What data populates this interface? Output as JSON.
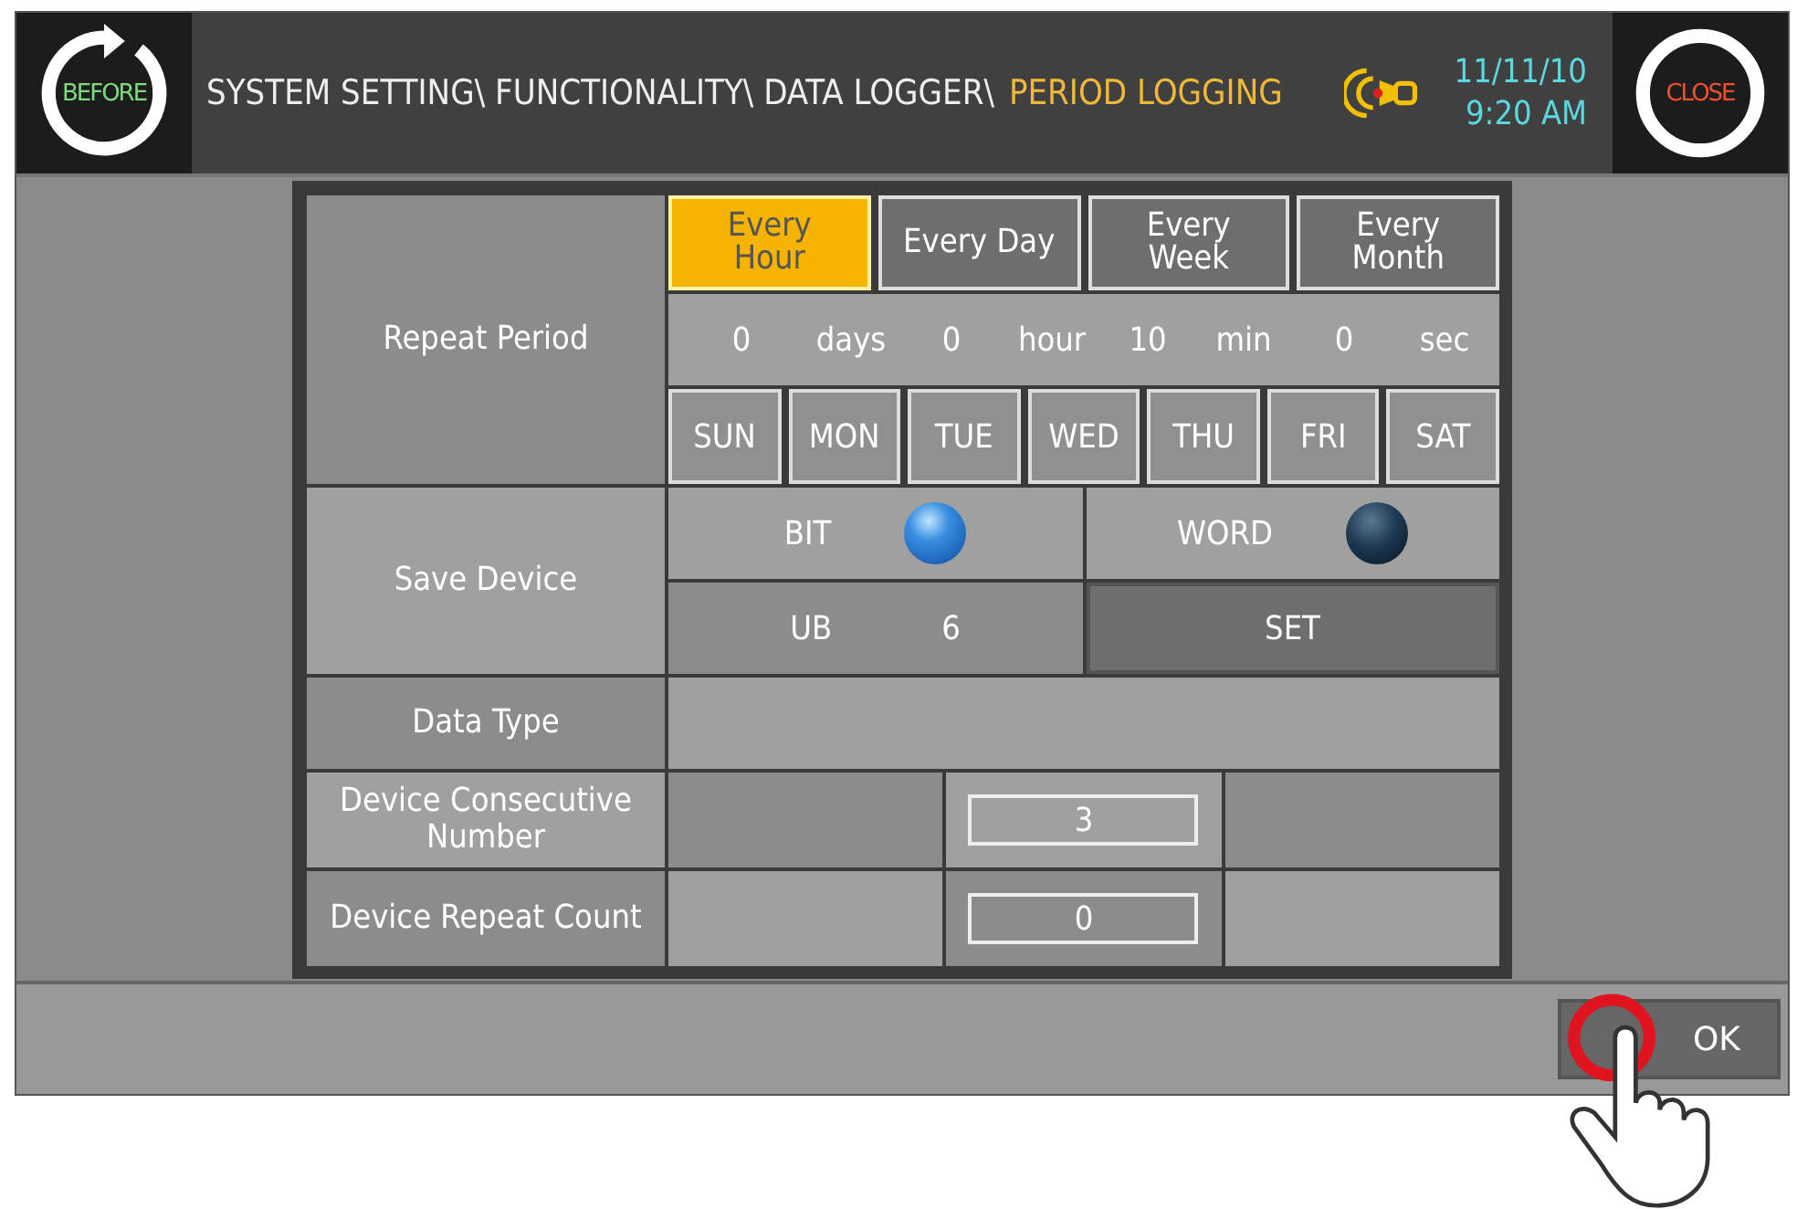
{
  "header": {
    "before_button": "BEFORE",
    "breadcrumb": "SYSTEM SETTING\\ FUNCTIONALITY\\ DATA LOGGER\\",
    "current_page": "PERIOD LOGGING",
    "date": "11/11/10",
    "time": "9:20 AM",
    "close_button": "CLOSE"
  },
  "repeat_period": {
    "label": "Repeat Period",
    "periods": [
      {
        "label": "Every Hour",
        "selected": true
      },
      {
        "label": "Every Day",
        "selected": false
      },
      {
        "label": "Every Week",
        "selected": false
      },
      {
        "label": "Every Month",
        "selected": false
      }
    ],
    "interval": [
      {
        "value": "0",
        "unit": "days"
      },
      {
        "value": "0",
        "unit": "hour"
      },
      {
        "value": "10",
        "unit": "min"
      },
      {
        "value": "0",
        "unit": "sec"
      }
    ],
    "weekdays": [
      "SUN",
      "MON",
      "TUE",
      "WED",
      "THU",
      "FRI",
      "SAT"
    ]
  },
  "save_device": {
    "label": "Save Device",
    "options": [
      {
        "label": "BIT",
        "selected": true
      },
      {
        "label": "WORD",
        "selected": false
      }
    ],
    "device": "UB",
    "address": "6",
    "set_button": "SET"
  },
  "data_type": {
    "label": "Data Type"
  },
  "consecutive_number": {
    "label": "Device Consecutive Number",
    "value": "3"
  },
  "repeat_count": {
    "label": "Device Repeat Count",
    "value": "0"
  },
  "ok_button": "OK"
}
